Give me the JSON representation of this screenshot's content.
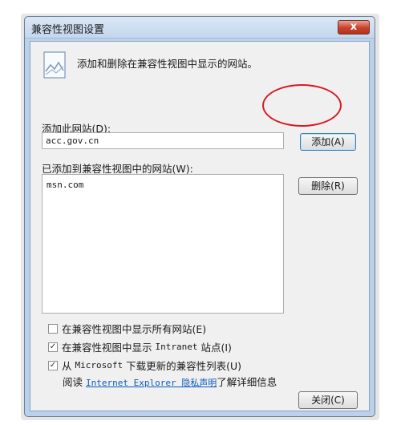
{
  "window": {
    "title": "兼容性视图设置",
    "close_symbol": "x"
  },
  "description": "添加和删除在兼容性视图中显示的网站。",
  "add_site": {
    "label": "添加此网站(D):",
    "value": "acc.gov.cn",
    "button_label": "添加(A)"
  },
  "site_list": {
    "label": "已添加到兼容性视图中的网站(W):",
    "items": [
      "msn.com"
    ],
    "remove_button_label": "删除(R)"
  },
  "options": {
    "show_all": {
      "label": "在兼容性视图中显示所有网站(E)",
      "checked": false
    },
    "intranet": {
      "label_prefix": "在兼容性视图中显示 ",
      "label_mono": "Intranet",
      "label_suffix": " 站点(I)",
      "checked": true
    },
    "download": {
      "label_prefix": "从 ",
      "label_mono": "Microsoft",
      "label_suffix": " 下载更新的兼容性列表(U)",
      "checked": true
    }
  },
  "privacy": {
    "prefix": "阅读 ",
    "link_text": "Internet Explorer 隐私声明",
    "suffix": "了解详细信息"
  },
  "footer": {
    "close_button_label": "关闭(C)"
  },
  "colors": {
    "annotation_circle": "#d81b22",
    "link": "#0a5bbf"
  }
}
